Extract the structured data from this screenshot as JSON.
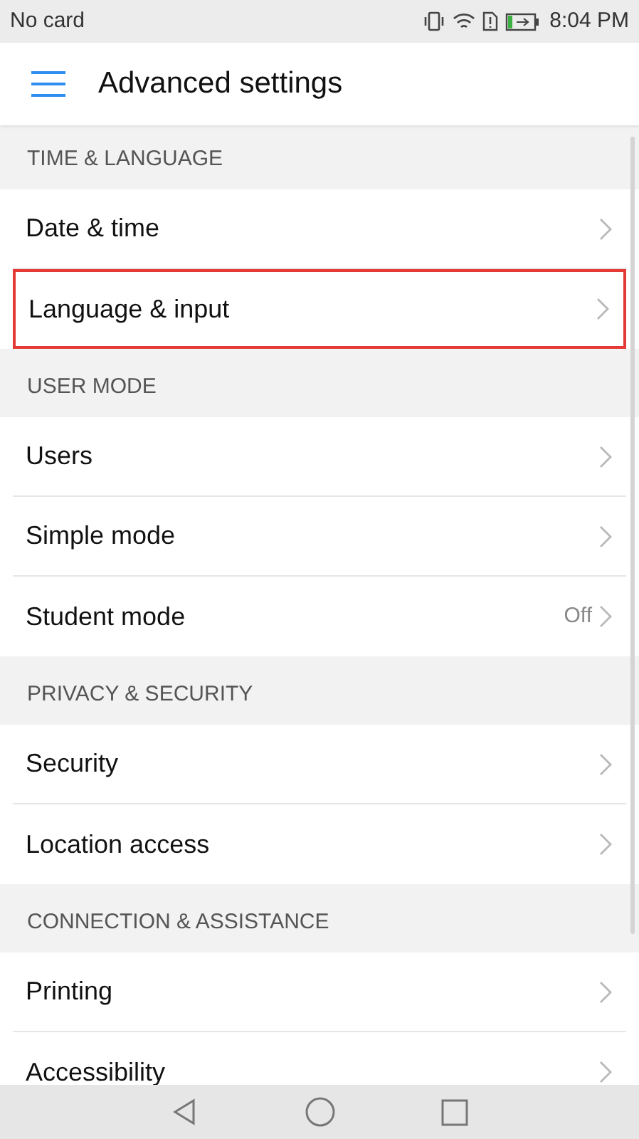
{
  "status_bar": {
    "carrier": "No card",
    "time": "8:04 PM"
  },
  "header": {
    "title": "Advanced settings"
  },
  "sections": [
    {
      "title": "TIME & LANGUAGE",
      "items": [
        {
          "label": "Date & time",
          "highlighted": false
        },
        {
          "label": "Language & input",
          "highlighted": true
        }
      ]
    },
    {
      "title": "USER MODE",
      "items": [
        {
          "label": "Users",
          "highlighted": false
        },
        {
          "label": "Simple mode",
          "highlighted": false
        },
        {
          "label": "Student mode",
          "value": "Off",
          "highlighted": false
        }
      ]
    },
    {
      "title": "PRIVACY & SECURITY",
      "items": [
        {
          "label": "Security",
          "highlighted": false
        },
        {
          "label": "Location access",
          "highlighted": false
        }
      ]
    },
    {
      "title": "CONNECTION & ASSISTANCE",
      "items": [
        {
          "label": "Printing",
          "highlighted": false
        },
        {
          "label": "Accessibility",
          "highlighted": false
        }
      ]
    }
  ]
}
